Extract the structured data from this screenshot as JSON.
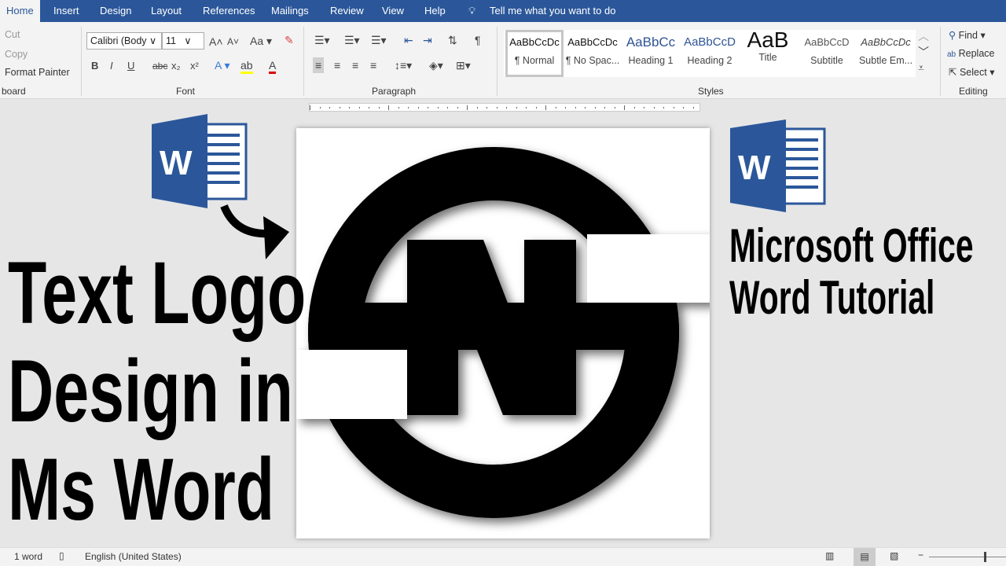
{
  "tabs": [
    {
      "label": "Home",
      "active": true
    },
    {
      "label": "Insert"
    },
    {
      "label": "Design"
    },
    {
      "label": "Layout"
    },
    {
      "label": "References"
    },
    {
      "label": "Mailings"
    },
    {
      "label": "Review"
    },
    {
      "label": "View"
    },
    {
      "label": "Help"
    }
  ],
  "tell_me": "Tell me what you want to do",
  "clipboard": {
    "cut": "Cut",
    "copy": "Copy",
    "format_painter": "Format Painter",
    "group": "board"
  },
  "font": {
    "name": "Calibri (Body",
    "size": "11",
    "change_case": "Aa",
    "group": "Font",
    "bold": "B",
    "italic": "I",
    "underline": "U",
    "strike": "abc",
    "sub": "x₂",
    "sup": "x²"
  },
  "paragraph": {
    "group": "Paragraph"
  },
  "styles": {
    "group": "Styles",
    "items": [
      {
        "preview": "AaBbCcDc",
        "name": "¶ Normal",
        "selected": true
      },
      {
        "preview": "AaBbCcDc",
        "name": "¶ No Spac..."
      },
      {
        "preview": "AaBbCc",
        "name": "Heading 1"
      },
      {
        "preview": "AaBbCcD",
        "name": "Heading 2"
      },
      {
        "preview": "AaB",
        "name": "Title"
      },
      {
        "preview": "AaBbCcD",
        "name": "Subtitle"
      },
      {
        "preview": "AaBbCcDc",
        "name": "Subtle Em..."
      }
    ]
  },
  "editing": {
    "find": "Find",
    "replace": "Replace",
    "select": "Select",
    "group": "Editing"
  },
  "thumbnail": {
    "left_lines": [
      "Text Logo",
      "Design in",
      "Ms Word"
    ],
    "right_lines": [
      "Microsoft Office",
      "Word Tutorial"
    ],
    "word_logo_letter": "W"
  },
  "status": {
    "words": "1 word",
    "language": "English (United States)"
  },
  "colors": {
    "tabbar": "#2b579a",
    "word_blue": "#2b579a",
    "logo": "#000000"
  }
}
